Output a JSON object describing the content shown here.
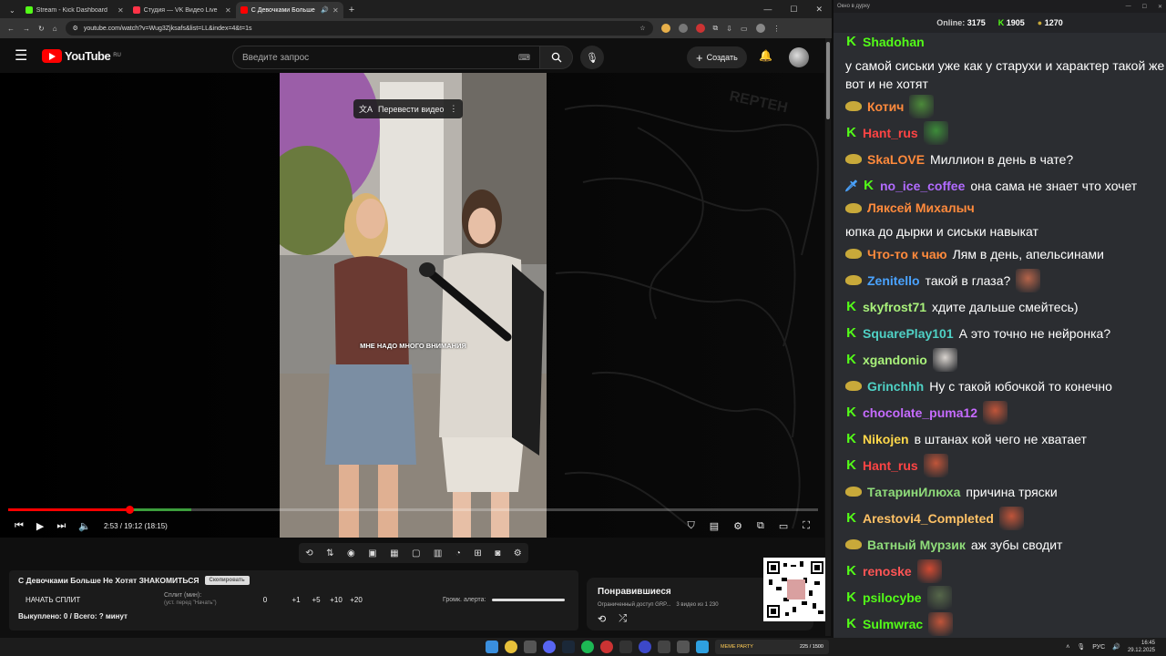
{
  "browser": {
    "tabs": [
      {
        "title": "Stream - Kick Dashboard",
        "color": "#53fc18",
        "active": false
      },
      {
        "title": "Студия — VK Видео Live",
        "color": "#ff3347",
        "active": false
      },
      {
        "title": "С Девочками Больше Не",
        "color": "#ff0000",
        "active": true
      }
    ],
    "url": "youtube.com/watch?v=Wug3Zjksafs&list=LL&index=4&t=1s"
  },
  "youtube": {
    "logo_text": "YouTube",
    "region": "RU",
    "search_placeholder": "Введите запрос",
    "create_label": "Создать",
    "translate_label": "Перевести видео",
    "subtitle": "МНЕ НАДО МНОГО ВНИМАНИЯ",
    "time": "2:53 / 19:12 (18:15)",
    "progress_fraction": 0.15
  },
  "split": {
    "title": "С Девочками Больше Не Хотят ЗНАКОМИТЬСЯ",
    "badge": "Скопировать",
    "start_label": "НАЧАТЬ СПЛИТ",
    "split_label": "Сплит (мин):",
    "split_hint": "(уст. перед \"Начать\")",
    "value": "0",
    "increments": [
      "+1",
      "+5",
      "+10",
      "+20"
    ],
    "alert_label": "Громк. алерта:",
    "footer": "Выкуплено: 0 / Всего: ? минут"
  },
  "liked": {
    "title": "Понравившиеся",
    "access": "Ограниченный доступ GRP...",
    "count": "3 видео из 1 230"
  },
  "chat": {
    "window_title": "Окно в дурку",
    "online_label": "Online:",
    "online_value": "3175",
    "kick_count": "1905",
    "cheese_count": "1270",
    "messages": [
      {
        "badges": [
          "kick"
        ],
        "user": "Shadohan",
        "color": "#53fc18",
        "text": "у самой сиськи уже как у старухи и характер такой же вот и не хотят",
        "emote": ""
      },
      {
        "badges": [
          "cheese"
        ],
        "user": "Котич",
        "color": "#ff8a3c",
        "text": "",
        "emote": "#4c8a3a"
      },
      {
        "badges": [
          "kick"
        ],
        "user": "Hant_rus",
        "color": "#ff4444",
        "text": "",
        "emote": "#3d8c3a"
      },
      {
        "badges": [
          "cheese"
        ],
        "user": "SkaLOVE",
        "color": "#ff8a3c",
        "text": "Миллион в день в чате?",
        "emote": ""
      },
      {
        "badges": [
          "sword",
          "kick"
        ],
        "user": "no_ice_coffee",
        "color": "#b26bff",
        "text": "она сама не знает что хочет",
        "emote": ""
      },
      {
        "badges": [
          "cheese"
        ],
        "user": "Ляксей Михалыч",
        "color": "#ff8a3c",
        "text": "юпка до дырки и сиськи навыкат",
        "emote": ""
      },
      {
        "badges": [
          "cheese"
        ],
        "user": "Что-то к чаю",
        "color": "#ff8a3c",
        "text": "Лям в день, апельсинами",
        "emote": ""
      },
      {
        "badges": [
          "cheese"
        ],
        "user": "Zenitello",
        "color": "#4aa3ff",
        "text": "такой в глаза?",
        "emote": "#b5644a"
      },
      {
        "badges": [
          "kick"
        ],
        "user": "skyfrost71",
        "color": "#a8f07a",
        "text": "хдите дальше смейтесь)",
        "emote": ""
      },
      {
        "badges": [
          "kick"
        ],
        "user": "SquarePlay101",
        "color": "#4fd1c5",
        "text": "А это точно не нейронка?",
        "emote": ""
      },
      {
        "badges": [
          "kick"
        ],
        "user": "xgandonio",
        "color": "#a8f07a",
        "text": "",
        "emote": "#d9d4cf"
      },
      {
        "badges": [
          "cheese"
        ],
        "user": "Grinchhh",
        "color": "#4fd1c5",
        "text": "Ну с такой юбочкой то конечно",
        "emote": ""
      },
      {
        "badges": [
          "kick"
        ],
        "user": "chocolate_puma12",
        "color": "#c66bff",
        "text": "",
        "emote": "#c0553a"
      },
      {
        "badges": [
          "kick"
        ],
        "user": "Nikojen",
        "color": "#ffd84a",
        "text": "в штанах кой чего не хватает",
        "emote": ""
      },
      {
        "badges": [
          "kick"
        ],
        "user": "Hant_rus",
        "color": "#ff4444",
        "text": "",
        "emote": "#c0553a"
      },
      {
        "badges": [
          "cheese"
        ],
        "user": "ТатаринИлюха",
        "color": "#8fdc7a",
        "text": "причина тряски",
        "emote": ""
      },
      {
        "badges": [
          "kick"
        ],
        "user": "Arestovi4_Completed",
        "color": "#ffc266",
        "text": "",
        "emote": "#c0553a"
      },
      {
        "badges": [
          "cheese"
        ],
        "user": "Ватный Мурзик",
        "color": "#8fdc7a",
        "text": "аж зубы сводит",
        "emote": ""
      },
      {
        "badges": [
          "kick"
        ],
        "user": "renoske",
        "color": "#ff5555",
        "text": "",
        "emote": "#d04a33"
      },
      {
        "badges": [
          "kick"
        ],
        "user": "psilocybe",
        "color": "#53fc18",
        "text": "",
        "emote": "#56674a"
      },
      {
        "badges": [
          "kick"
        ],
        "user": "Sulmwrac",
        "color": "#53fc18",
        "text": "",
        "emote": "#c0553a"
      }
    ]
  },
  "taskbar": {
    "meme_label": "MEME PARTY",
    "meme_value": "225 / 1500",
    "lang": "РУС",
    "time": "16:45",
    "date": "29.12.2025"
  }
}
